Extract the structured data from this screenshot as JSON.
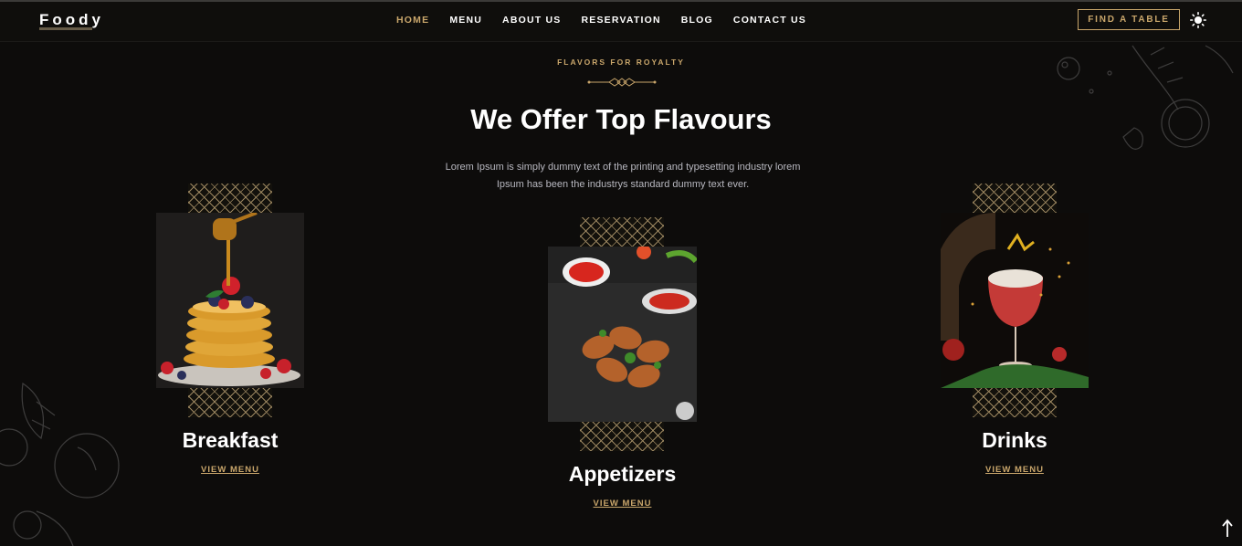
{
  "brand": {
    "logo": "Foody"
  },
  "nav": {
    "items": [
      {
        "label": "HOME",
        "active": true
      },
      {
        "label": "MENU",
        "active": false
      },
      {
        "label": "ABOUT US",
        "active": false
      },
      {
        "label": "RESERVATION",
        "active": false
      },
      {
        "label": "BLOG",
        "active": false
      },
      {
        "label": "CONTACT US",
        "active": false
      }
    ],
    "cta": "FIND A TABLE",
    "theme_icon": "sun-icon"
  },
  "section": {
    "kicker": "FLAVORS FOR ROYALTY",
    "title": "We Offer Top Flavours",
    "description_line1": "Lorem Ipsum is simply dummy text of the printing and typesetting industry lorem",
    "description_line2": "Ipsum has been the industrys standard dummy text ever."
  },
  "cards": [
    {
      "title": "Breakfast",
      "link": "VIEW MENU"
    },
    {
      "title": "Appetizers",
      "link": "VIEW MENU"
    },
    {
      "title": "Drinks",
      "link": "VIEW MENU"
    }
  ],
  "colors": {
    "accent": "#c9a66b",
    "background": "#0d0c0b"
  },
  "scroll_top_icon": "arrow-up-icon"
}
